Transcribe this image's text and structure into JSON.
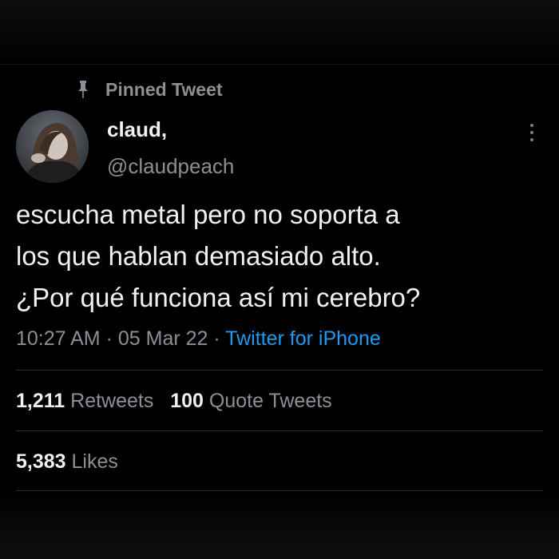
{
  "pinned_label": "Pinned Tweet",
  "user": {
    "display_name": "claud,",
    "handle": "@claudpeach"
  },
  "tweet": {
    "lines": [
      "escucha metal pero no soporta a",
      "los que hablan demasiado alto.",
      "¿Por qué funciona así mi cerebro?"
    ],
    "time": "10:27 AM",
    "date": "05 Mar 22",
    "source": "Twitter for iPhone",
    "separator": "·"
  },
  "stats": {
    "retweets_count": "1,211",
    "retweets_label": "Retweets",
    "quotes_count": "100",
    "quotes_label": "Quote Tweets",
    "likes_count": "5,383",
    "likes_label": "Likes"
  },
  "icons": {
    "pin": "pin-icon",
    "more": "more-menu-icon"
  },
  "colors": {
    "background": "#000000",
    "text_primary": "#f1f1f1",
    "text_secondary": "#8b9096",
    "accent": "#1d9bf0"
  }
}
